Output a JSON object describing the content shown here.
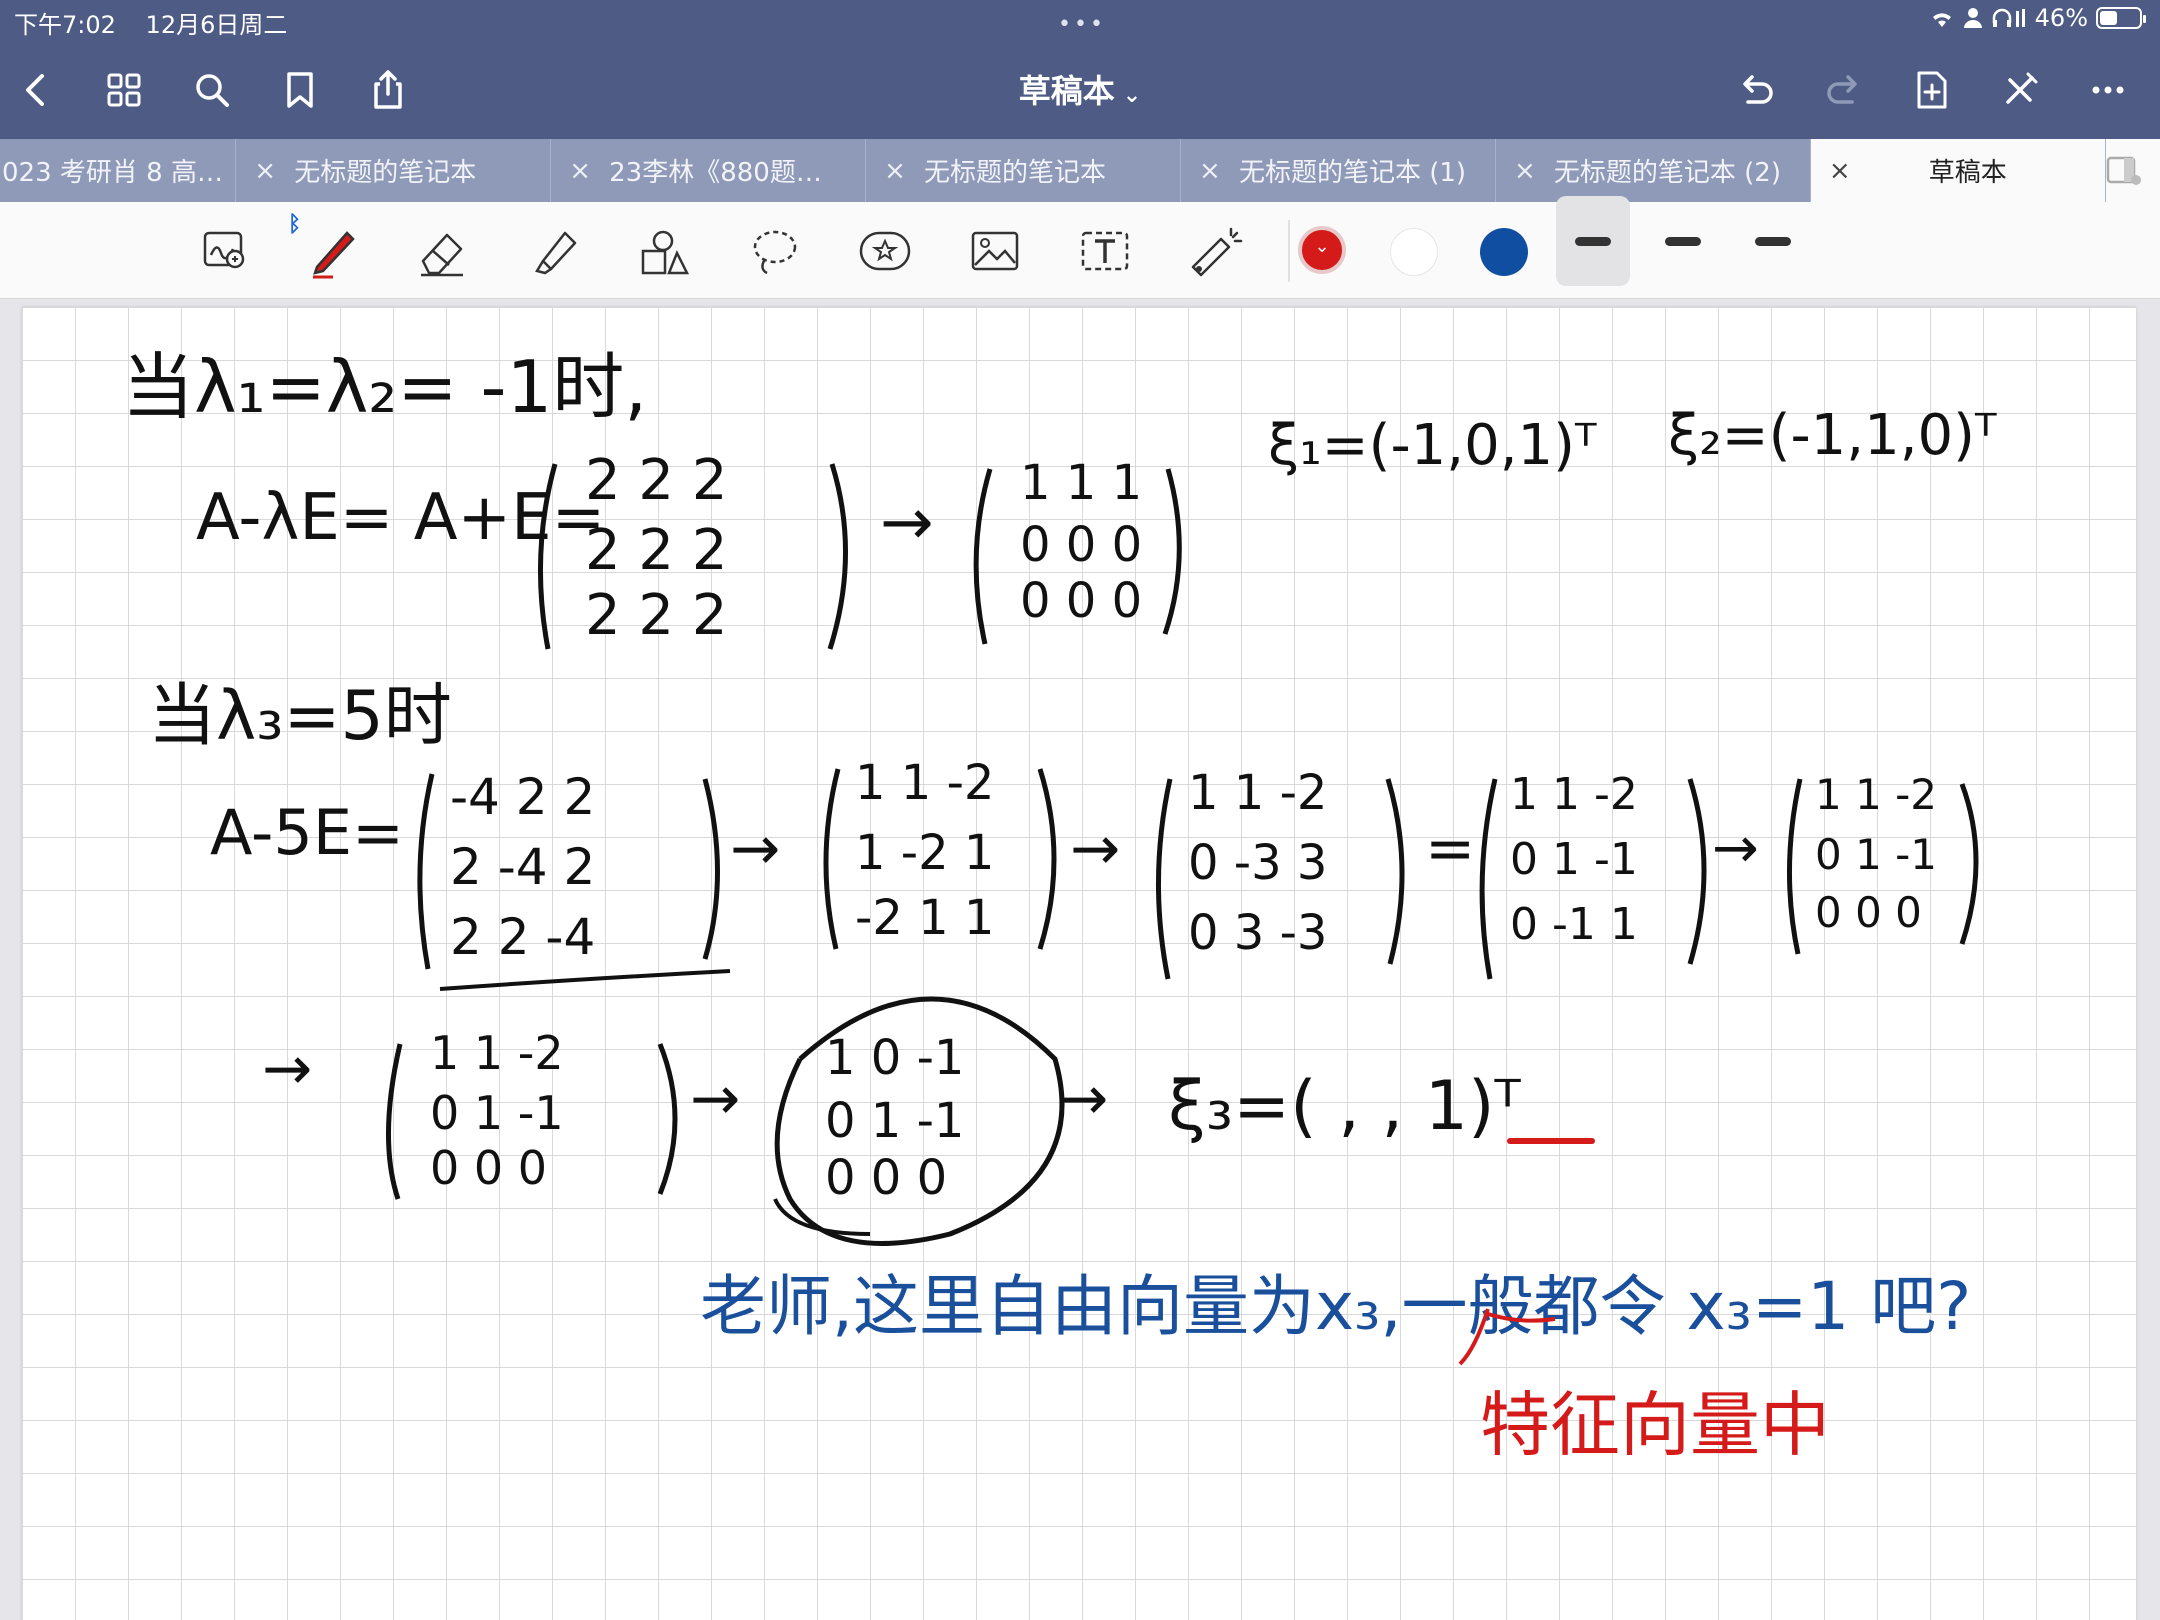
{
  "status_bar": {
    "time": "下午7:02",
    "date": "12月6日周二",
    "battery": "46%",
    "battery_level": 0.46
  },
  "nav": {
    "title": "草稿本",
    "icons": [
      "chevron-left-icon",
      "grid-icon",
      "search-icon",
      "bookmark-icon",
      "share-icon",
      "undo-icon",
      "redo-icon",
      "add-page-icon",
      "close-pen-icon",
      "more-icon"
    ]
  },
  "tabs": [
    {
      "label": "023 考研肖 8 高…",
      "close": ""
    },
    {
      "label": "无标题的笔记本",
      "close": "×"
    },
    {
      "label": "23李林《880题…",
      "close": "×"
    },
    {
      "label": "无标题的笔记本",
      "close": "×"
    },
    {
      "label": "无标题的笔记本 (1)",
      "close": "×"
    },
    {
      "label": "无标题的笔记本 (2)",
      "close": "×"
    },
    {
      "label": "草稿本",
      "close": "×",
      "active": true
    }
  ],
  "toolbar": {
    "tools": [
      "zoom-lasso-icon",
      "pen-icon",
      "eraser-icon",
      "highlighter-icon",
      "shapes-icon",
      "lasso-icon",
      "sticker-icon",
      "image-icon",
      "text-icon",
      "laser-pointer-icon"
    ],
    "colors": [
      "#d51a1a",
      "#ffffff",
      "#0f4ea0"
    ],
    "selected_color": "#d51a1a",
    "stroke_options": 3,
    "selected_stroke": 0
  },
  "notes": {
    "line1": "当λ₁=λ₂= -1时,",
    "line2": "A-λE= A+E=",
    "xi1": "ξ₁=(-1,0,1)ᵀ",
    "xi2": "ξ₂=(-1,1,0)ᵀ",
    "m1": [
      "2 2 2",
      "2 2 2",
      "2 2 2"
    ],
    "m2": [
      "1 1 1",
      "0 0 0",
      "0 0 0"
    ],
    "line3": "当λ₃=5时",
    "line4": "A-5E=",
    "m3": [
      "-4 2 2",
      "2 -4 2",
      "2 2 -4"
    ],
    "m4": [
      "1 1 -2",
      "1 -2 1",
      "-2 1 1"
    ],
    "m5": [
      "1 1 -2",
      "0 -3 3",
      "0 3 -3"
    ],
    "m6": [
      "1 1 -2",
      "0 1 -1",
      "0 -1 1"
    ],
    "m7": [
      "1 1 -2",
      "0 1 -1",
      "0 0 0"
    ],
    "m8": [
      "1 1 -2",
      "0 1 -1",
      "0 0 0"
    ],
    "m9": [
      "1 0 -1",
      "0 1 -1",
      "0 0 0"
    ],
    "xi3": "ξ₃=( , , 1)ᵀ",
    "question": "老师,这里自由向量为x₃,一般都令 x₃=1 吧?",
    "insertion": "特征向量中",
    "arrow": "→",
    "equals": "="
  }
}
